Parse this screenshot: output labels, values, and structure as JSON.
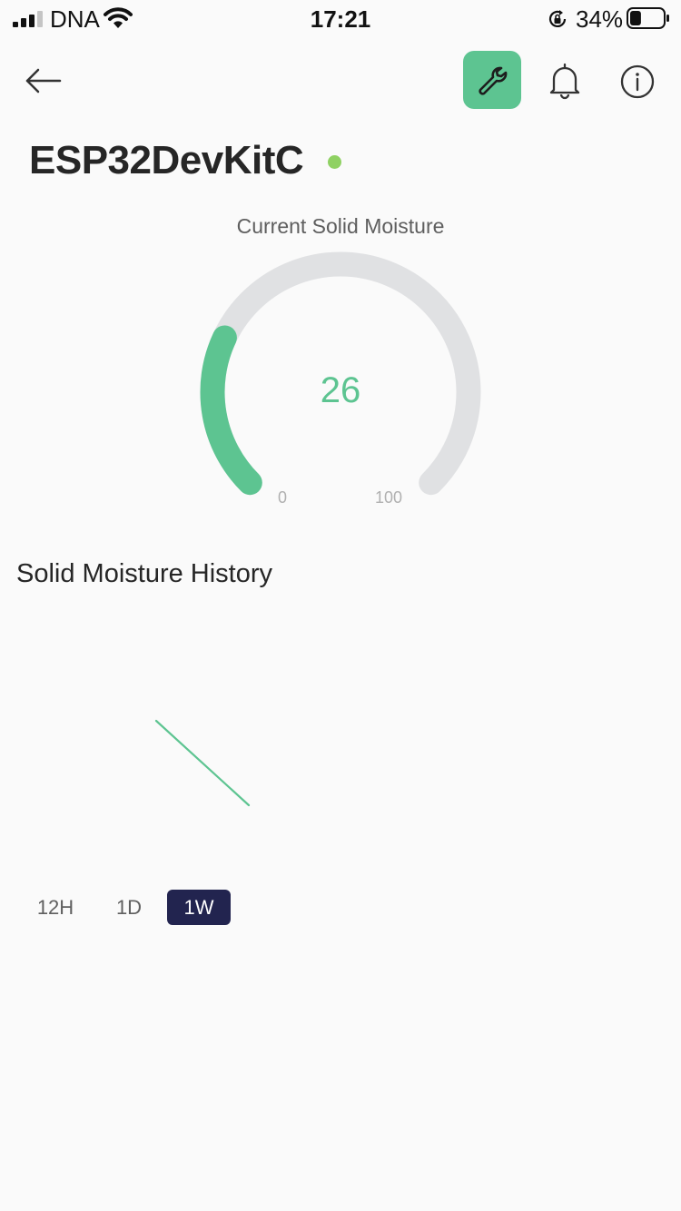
{
  "status_bar": {
    "carrier": "DNA",
    "time": "17:21",
    "battery_percent": "34%",
    "battery_level": 0.34,
    "icons": [
      "signal-icon",
      "wifi-icon",
      "rotation-lock-icon",
      "battery-icon"
    ]
  },
  "header": {
    "icons": [
      "back-arrow-icon",
      "wrench-icon",
      "bell-icon",
      "info-icon"
    ],
    "active_color": "#5dc491"
  },
  "device": {
    "name": "ESP32DevKitC",
    "status_color": "#8fd163"
  },
  "gauge": {
    "label": "Current Solid Moisture",
    "value": "26",
    "min": "0",
    "max": "100",
    "fraction": 0.26,
    "fill_color": "#5dc491",
    "track_color": "#e0e1e3"
  },
  "history": {
    "title": "Solid Moisture History",
    "ranges": [
      {
        "label": "12H",
        "active": false
      },
      {
        "label": "1D",
        "active": false
      },
      {
        "label": "1W",
        "active": true
      }
    ],
    "active_color": "#22244f"
  }
}
